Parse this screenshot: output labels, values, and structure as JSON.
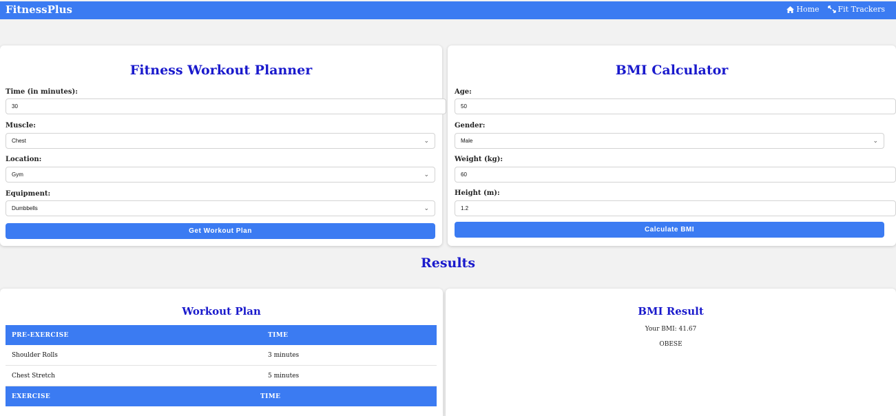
{
  "nav": {
    "brand": "FitnessPlus",
    "home": {
      "label": "Home",
      "icon": "home-icon"
    },
    "trackers": {
      "label": "Fit Trackers",
      "icon": "expand-icon"
    }
  },
  "planner": {
    "title": "Fitness Workout Planner",
    "time": {
      "label": "Time (in minutes):",
      "value": "30"
    },
    "muscle": {
      "label": "Muscle:",
      "value": "Chest"
    },
    "location": {
      "label": "Location:",
      "value": "Gym"
    },
    "equipment": {
      "label": "Equipment:",
      "value": "Dumbbells"
    },
    "button": "Get Workout Plan"
  },
  "bmi": {
    "title": "BMI Calculator",
    "age": {
      "label": "Age:",
      "value": "50"
    },
    "gender": {
      "label": "Gender:",
      "value": "Male"
    },
    "weight": {
      "label": "Weight (kg):",
      "value": "60"
    },
    "height": {
      "label": "Height (m):",
      "value": "1.2"
    },
    "button": "Calculate BMI"
  },
  "results": {
    "title": "Results",
    "workout": {
      "title": "Workout Plan",
      "pre_header": [
        "PRE-EXERCISE",
        "TIME"
      ],
      "pre_rows": [
        [
          "Shoulder Rolls",
          "3 minutes"
        ],
        [
          "Chest Stretch",
          "5 minutes"
        ]
      ],
      "ex_header": [
        "EXERCISE",
        "TIME"
      ]
    },
    "bmi": {
      "title": "BMI Result",
      "value_text": "Your BMI: 41.67",
      "category": "OBESE"
    }
  },
  "colors": {
    "accent": "#3b7bf2",
    "heading": "#1a1acc",
    "background": "#f2f2f2"
  }
}
